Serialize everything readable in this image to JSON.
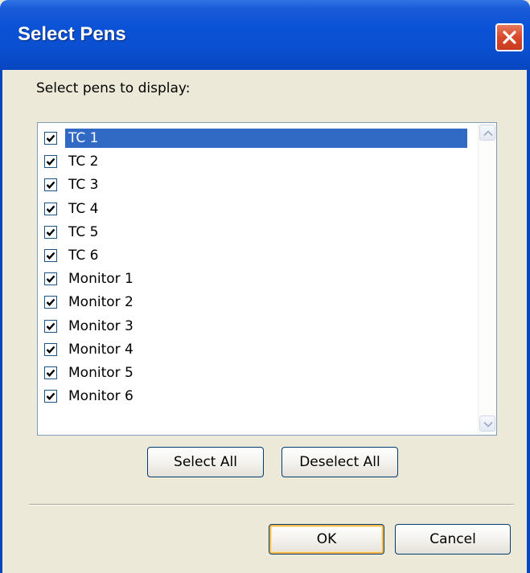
{
  "window": {
    "title": "Select Pens"
  },
  "prompt": "Select pens to display:",
  "pens": [
    {
      "label": "TC 1",
      "checked": true,
      "selected": true
    },
    {
      "label": "TC 2",
      "checked": true,
      "selected": false
    },
    {
      "label": "TC 3",
      "checked": true,
      "selected": false
    },
    {
      "label": "TC 4",
      "checked": true,
      "selected": false
    },
    {
      "label": "TC 5",
      "checked": true,
      "selected": false
    },
    {
      "label": "TC 6",
      "checked": true,
      "selected": false
    },
    {
      "label": "Monitor 1",
      "checked": true,
      "selected": false
    },
    {
      "label": "Monitor 2",
      "checked": true,
      "selected": false
    },
    {
      "label": "Monitor 3",
      "checked": true,
      "selected": false
    },
    {
      "label": "Monitor 4",
      "checked": true,
      "selected": false
    },
    {
      "label": "Monitor 5",
      "checked": true,
      "selected": false
    },
    {
      "label": "Monitor 6",
      "checked": true,
      "selected": false
    }
  ],
  "buttons": {
    "select_all": "Select All",
    "deselect_all": "Deselect All",
    "ok": "OK",
    "cancel": "Cancel"
  },
  "icons": {
    "close": "close-icon",
    "check": "checkmark-icon",
    "scroll_up": "chevron-up-icon",
    "scroll_down": "chevron-down-icon"
  },
  "colors": {
    "titlebar": "#0a52d6",
    "selection": "#316ac5",
    "dialog_bg": "#ece9d8",
    "close_button": "#d8482a"
  }
}
